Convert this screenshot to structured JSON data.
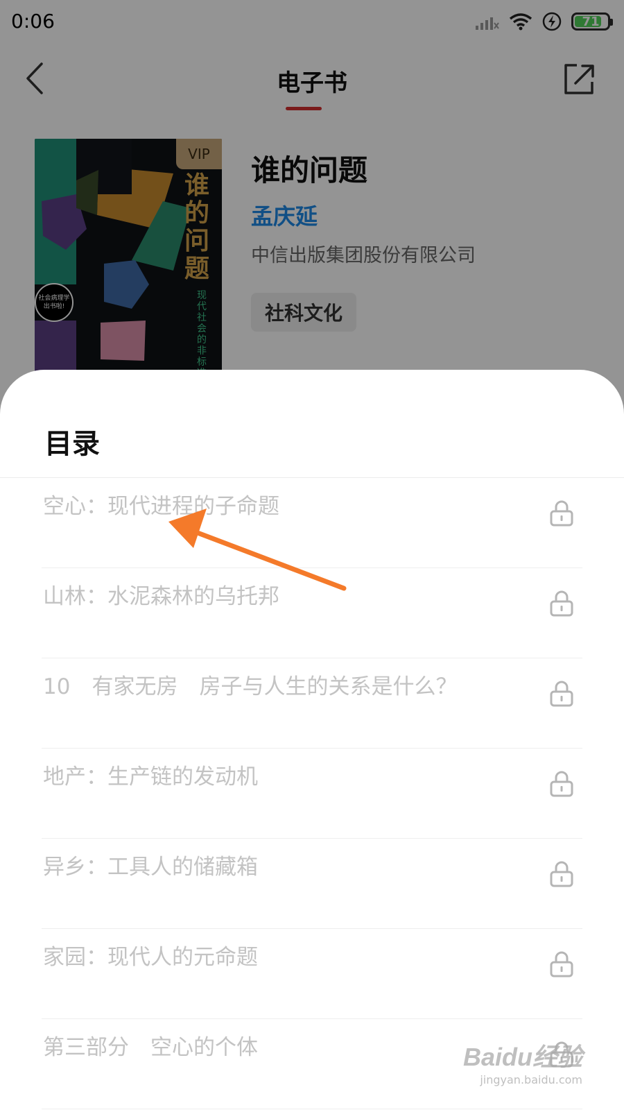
{
  "status_bar": {
    "time": "0:06",
    "battery": "71"
  },
  "header": {
    "title": "电子书"
  },
  "book": {
    "cover": {
      "vip": "VIP",
      "title_chars": "谁的问题",
      "subtitle": "现代社会的非标准答案",
      "badge": "社会病理学 出书啦!"
    },
    "title": "谁的问题",
    "author": "孟庆延",
    "publisher": "中信出版集团股份有限公司",
    "category": "社科文化"
  },
  "toc": {
    "title": "目录",
    "items": [
      {
        "label": "空心：现代进程的子命题",
        "locked": true
      },
      {
        "label": "山林：水泥森林的乌托邦",
        "locked": true
      },
      {
        "label": "10　有家无房　房子与人生的关系是什么？",
        "locked": true
      },
      {
        "label": "地产：生产链的发动机",
        "locked": true
      },
      {
        "label": "异乡：工具人的储藏箱",
        "locked": true
      },
      {
        "label": "家园：现代人的元命题",
        "locked": true
      },
      {
        "label": "第三部分　空心的个体",
        "locked": true
      }
    ]
  },
  "annotation": {
    "color": "#f47a2a"
  },
  "watermark": {
    "logo": "Baidu经验",
    "url": "jingyan.baidu.com"
  },
  "colors": {
    "accent": "#d32f2f",
    "author": "#1e88e5",
    "battery": "#52d15a"
  }
}
